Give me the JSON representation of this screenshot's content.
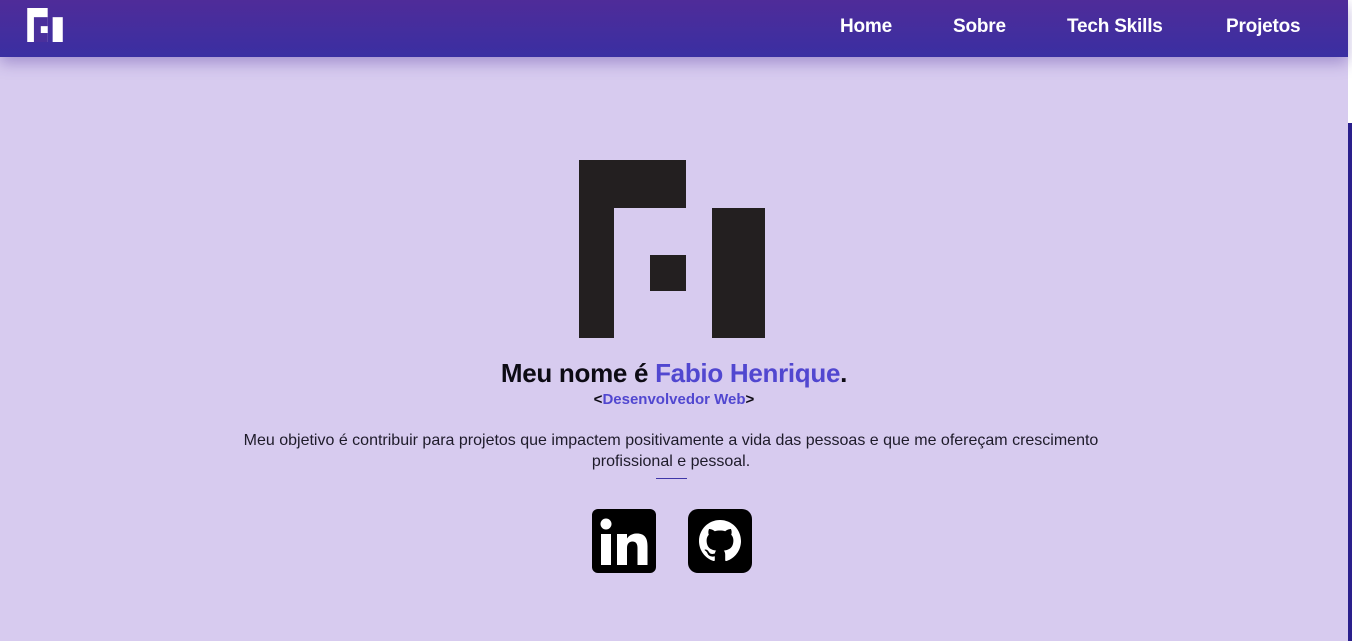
{
  "nav": {
    "logo_icon": "fh-logo-icon",
    "links": [
      {
        "label": "Home"
      },
      {
        "label": "Sobre"
      },
      {
        "label": "Tech Skills"
      },
      {
        "label": "Projetos"
      }
    ]
  },
  "hero": {
    "logo_icon": "fh-logo-icon",
    "headline_prefix": "Meu nome é ",
    "headline_name": "Fabio Henrique",
    "headline_suffix": ".",
    "role_open": "<",
    "role": "Desenvolvedor Web",
    "role_close": ">",
    "objective": "Meu objetivo é contribuir para projetos que impactem positivamente a vida das pessoas e que me ofereçam crescimento profissional e pessoal."
  },
  "social": [
    {
      "icon": "linkedin-icon"
    },
    {
      "icon": "github-icon"
    }
  ],
  "colors": {
    "navbar": "#3a2fa2",
    "background": "#d7cbef",
    "accent": "#5147d0",
    "logo_dark": "#231f20"
  }
}
